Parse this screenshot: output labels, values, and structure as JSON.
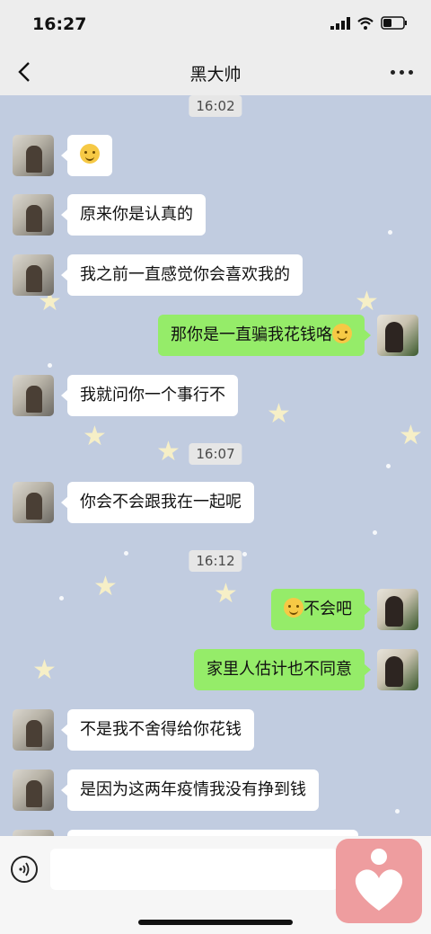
{
  "status": {
    "time": "16:27"
  },
  "header": {
    "title": "黑大帅"
  },
  "timestamps": [
    "16:02",
    "16:07",
    "16:12"
  ],
  "messages": [
    {
      "side": "left",
      "text": ""
    },
    {
      "side": "left",
      "text": "原来你是认真的"
    },
    {
      "side": "left",
      "text": "我之前一直感觉你会喜欢我的"
    },
    {
      "side": "right",
      "text": "那你是一直骗我花钱咯"
    },
    {
      "side": "left",
      "text": "我就问你一个事行不"
    },
    {
      "side": "left",
      "text": "你会不会跟我在一起呢"
    },
    {
      "side": "right",
      "text": "不会吧"
    },
    {
      "side": "right",
      "text": "家里人估计也不同意"
    },
    {
      "side": "left",
      "text": "不是我不舍得给你花钱"
    },
    {
      "side": "left",
      "text": "是因为这两年疫情我没有挣到钱"
    }
  ],
  "colors": {
    "chat_bg": "#c1cce0",
    "bubble_right": "#95ec69",
    "bubble_left": "#ffffff",
    "app_icon": "#ee9d9f"
  },
  "icons": [
    "back-icon",
    "more-icon",
    "voice-icon",
    "heart-app-icon",
    "smiley-emoji",
    "laugh-emoji"
  ]
}
